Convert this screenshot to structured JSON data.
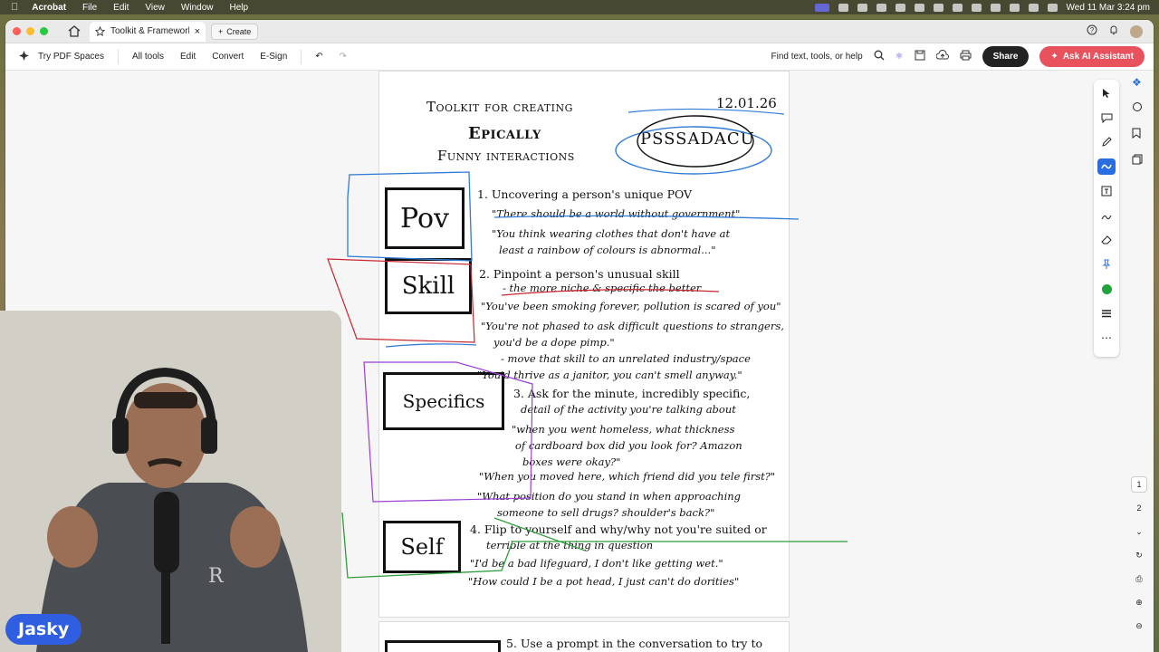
{
  "menubar": {
    "app": "Acrobat",
    "items": [
      "File",
      "Edit",
      "View",
      "Window",
      "Help"
    ],
    "datetime": "Wed 11 Mar  3:24 pm"
  },
  "tabs": {
    "doc_title": "Toolkit & Framework ...",
    "create_label": "Create"
  },
  "toolbar": {
    "pdf_spaces": "Try PDF Spaces",
    "all_tools": "All tools",
    "edit": "Edit",
    "convert": "Convert",
    "esign": "E-Sign",
    "find": "Find text, tools, or help",
    "share": "Share",
    "ai": "Ask AI Assistant"
  },
  "page": {
    "title_line1": "Toolkit for creating",
    "title_line2": "Epically",
    "title_line3": "Funny interactions",
    "date": "12.01.26",
    "acronym": "PSSSADACU",
    "boxes": {
      "pov": "Pov",
      "skill": "Skill",
      "specifics": "Specifics",
      "self": "Self"
    },
    "steps": [
      "1. Uncovering a person's unique POV",
      "2. Pinpoint a person's unusual skill",
      "3. Ask for the minute, incredibly specific,",
      "4. Flip to yourself and why/why not you're suited or"
    ],
    "lines": {
      "pov_q1": "\"There should be a world without government\"",
      "pov_q2a": "\"You think wearing clothes that don't have at",
      "pov_q2b": "least a rainbow of colours is abnormal...\"",
      "skill_sub": "- the more niche & specific the better",
      "skill_q1": "\"You've been smoking forever, pollution is scared of you\"",
      "skill_q2a": "\"You're not phased to ask difficult questions to strangers,",
      "skill_q2b": "you'd be a dope pimp.\"",
      "skill_move": "- move that skill to an unrelated industry/space",
      "skill_q3": "\"You'd thrive as a janitor, you can't smell anyway.\"",
      "spec_line2": "detail of the activity you're talking about",
      "spec_q1a": "\"when you went homeless, what thickness",
      "spec_q1b": "of cardboard box did you look for? Amazon",
      "spec_q1c": "boxes were okay?\"",
      "spec_q2": "\"When you moved here, which friend did you tele first?\"",
      "spec_q3a": "\"What position do you stand in when approaching",
      "spec_q3b": "someone to sell drugs? shoulder's back?\"",
      "self_line2": "terrible at the thing in question",
      "self_q1": "\"I'd be a bad lifeguard, I don't like getting wet.\"",
      "self_q2": "\"How could I be a pot head, I just can't do dorities\"",
      "next_step": "5. Use a prompt in the conversation to try to"
    }
  },
  "page_nav": [
    "1",
    "2"
  ],
  "webcam": {
    "badge": "Jasky",
    "shirt_text": "R"
  },
  "colors": {
    "annot_blue": "#2f7bd6",
    "annot_red": "#c9252e",
    "annot_purple": "#9b3fd6",
    "annot_green": "#2e9d3a",
    "ai_button": "#e8525c",
    "badge": "#2f5ee0"
  }
}
